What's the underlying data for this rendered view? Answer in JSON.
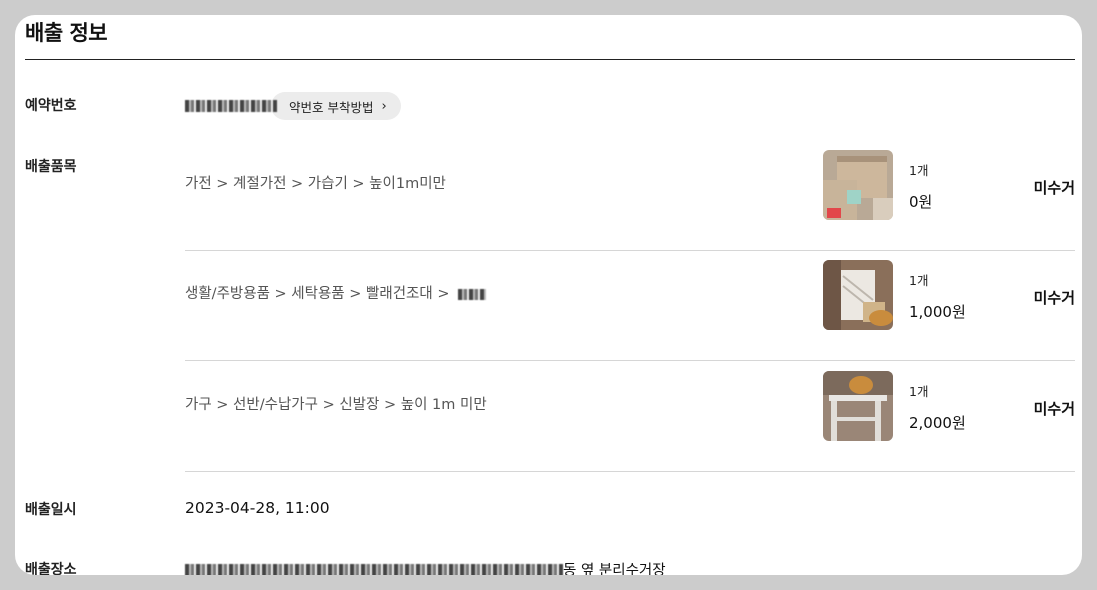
{
  "section": {
    "title": "배출 정보"
  },
  "reservation": {
    "label": "예약번호",
    "guide_label": "약번호 부착방법"
  },
  "items": {
    "label": "배출품목",
    "rows": [
      {
        "path": "가전 > 계절가전 > 가습기 > 높이1m미만",
        "qty": "1개",
        "price": "0원",
        "status": "미수거"
      },
      {
        "path": "생활/주방용품 > 세탁용품 > 빨래건조대 >",
        "qty": "1개",
        "price": "1,000원",
        "status": "미수거"
      },
      {
        "path": "가구 > 선반/수납가구 > 신발장 > 높이 1m 미만",
        "qty": "1개",
        "price": "2,000원",
        "status": "미수거"
      }
    ]
  },
  "datetime": {
    "label": "배출일시",
    "value": "2023-04-28, 11:00"
  },
  "place": {
    "label": "배출장소",
    "suffix": "동 옆 분리수거장"
  },
  "icons": {
    "chevron": "chevron-right-icon"
  },
  "colors": {
    "background": "#cccccc",
    "card": "#ffffff",
    "pill": "#ececec",
    "divider": "#d6d6d6"
  }
}
